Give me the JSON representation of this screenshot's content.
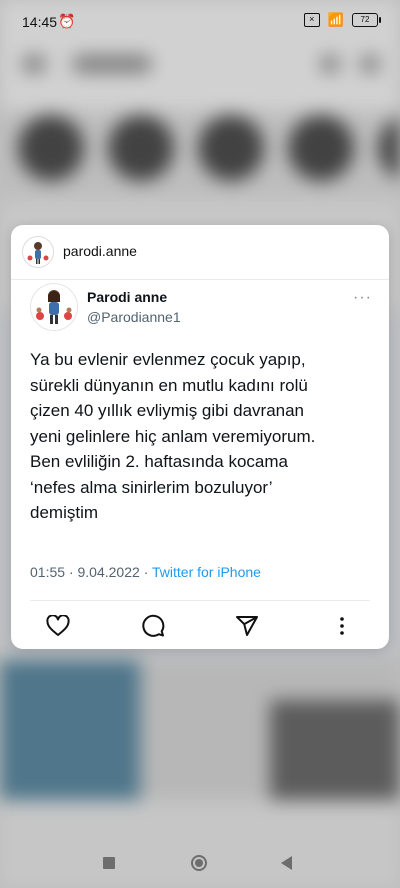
{
  "status_bar": {
    "time": "14:45",
    "alarm_glyph": "⏰",
    "wifi_glyph": "📶",
    "battery": "72"
  },
  "preview": {
    "username": "parodi.anne",
    "tweet": {
      "name": "Parodi anne",
      "handle": "@Parodianne1",
      "more": "···",
      "text": "Ya bu evlenir evlenmez çocuk yapıp,\nsürekli dünyanın en mutlu kadını rolü\nçizen 40 yıllık evliymiş gibi davranan\nyeni gelinlere hiç anlam veremiyorum.\nBen evliliğin 2. haftasında kocama\n‘nefes alma sinirlerim bozuluyor’\ndemiştim",
      "time": "01:55",
      "date": "9.04.2022",
      "dot": "·",
      "source": "Twitter for iPhone"
    },
    "actions": [
      "heart-icon",
      "comment-icon",
      "share-icon",
      "more-vertical-icon"
    ]
  },
  "nav": [
    "recent-apps-icon",
    "home-icon",
    "back-icon"
  ]
}
